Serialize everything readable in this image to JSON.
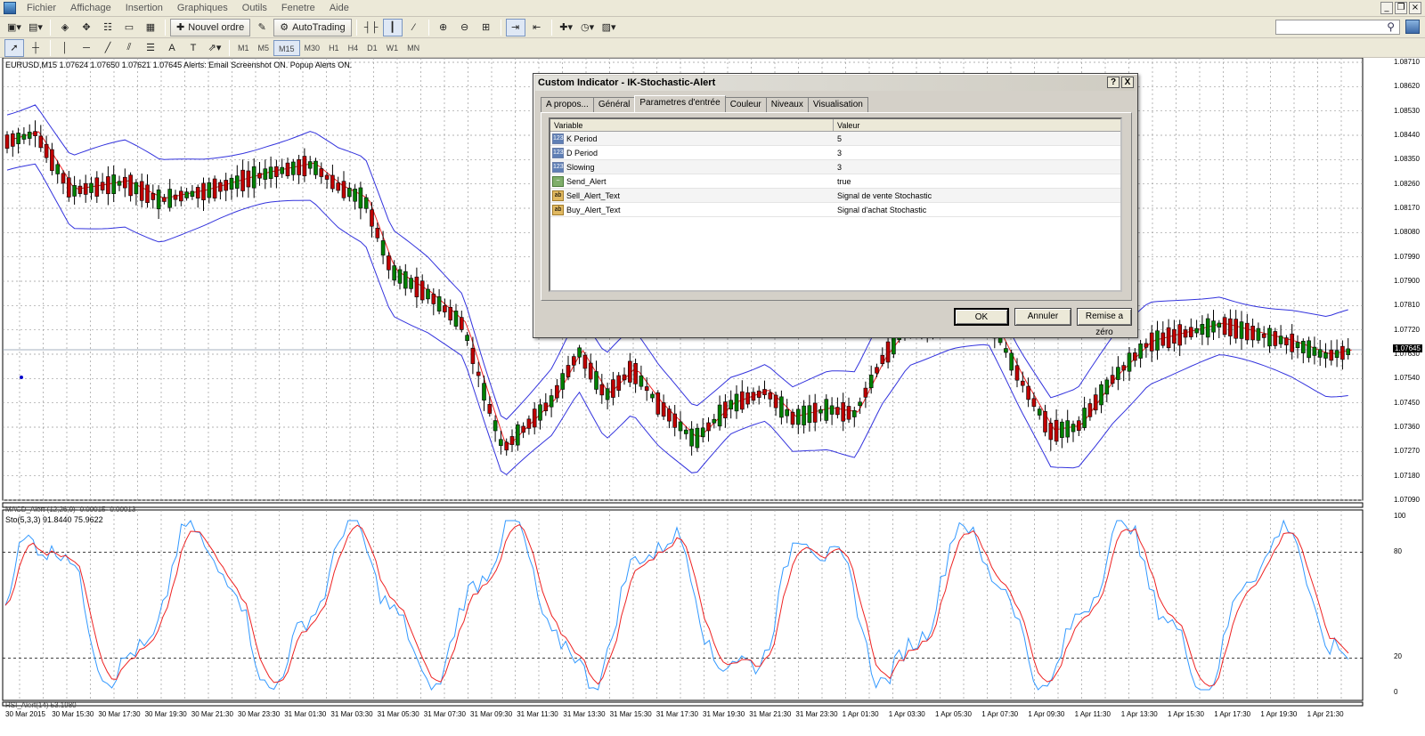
{
  "menubar": {
    "items": [
      "Fichier",
      "Affichage",
      "Insertion",
      "Graphiques",
      "Outils",
      "Fenetre",
      "Aide"
    ]
  },
  "toolbar": {
    "new_order_label": "Nouvel ordre",
    "autotrading_label": "AutoTrading",
    "timeframes": [
      "M1",
      "M5",
      "M15",
      "M30",
      "H1",
      "H4",
      "D1",
      "W1",
      "MN"
    ],
    "active_timeframe": "M15"
  },
  "chart": {
    "header": "EURUSD,M15  1.07624 1.07650 1.07621 1.07645  Alerts:  Email Screenshot ON.  Popup Alerts ON.",
    "macd_label": "MACD_Alert (12,26,9) -0.00015 -0.00013",
    "sto_label": "Sto(5,3,3) 91.8440 75.9622",
    "rsi_label": "RSI_Alert(14) 53.1980",
    "price_labels": [
      "1.08710",
      "1.08620",
      "1.08530",
      "1.08440",
      "1.08350",
      "1.08260",
      "1.08170",
      "1.08080",
      "1.07990",
      "1.07900",
      "1.07810",
      "1.07720",
      "1.07630",
      "1.07540",
      "1.07450",
      "1.07360",
      "1.07270",
      "1.07180",
      "1.07090"
    ],
    "current_price": "1.07645",
    "sto_scale": [
      "100",
      "80",
      "20",
      "0"
    ],
    "time_labels": [
      "30 Mar 2015",
      "30 Mar 15:30",
      "30 Mar 17:30",
      "30 Mar 19:30",
      "30 Mar 21:30",
      "30 Mar 23:30",
      "31 Mar 01:30",
      "31 Mar 03:30",
      "31 Mar 05:30",
      "31 Mar 07:30",
      "31 Mar 09:30",
      "31 Mar 11:30",
      "31 Mar 13:30",
      "31 Mar 15:30",
      "31 Mar 17:30",
      "31 Mar 19:30",
      "31 Mar 21:30",
      "31 Mar 23:30",
      "1 Apr 01:30",
      "1 Apr 03:30",
      "1 Apr 05:30",
      "1 Apr 07:30",
      "1 Apr 09:30",
      "1 Apr 11:30",
      "1 Apr 13:30",
      "1 Apr 15:30",
      "1 Apr 17:30",
      "1 Apr 19:30",
      "1 Apr 21:30"
    ],
    "colors": {
      "bull": "#008000",
      "bear": "#c00000",
      "bands": "#3333dd",
      "ma": "#ee2222",
      "sto_main": "#3399ff",
      "sto_signal": "#ee2222"
    }
  },
  "dialog": {
    "title": "Custom Indicator - IK-Stochastic-Alert",
    "help_label": "?",
    "close_label": "X",
    "tabs": [
      "A propos...",
      "Général",
      "Parametres d'entrée",
      "Couleur",
      "Niveaux",
      "Visualisation"
    ],
    "active_tab": "Parametres d'entrée",
    "columns": {
      "variable": "Variable",
      "value": "Valeur"
    },
    "params": [
      {
        "type": "int",
        "icon": "123",
        "name": "K Period",
        "value": "5"
      },
      {
        "type": "int",
        "icon": "123",
        "name": "D Period",
        "value": "3"
      },
      {
        "type": "int",
        "icon": "123",
        "name": "Slowing",
        "value": "3"
      },
      {
        "type": "bool",
        "icon": "~",
        "name": "Send_Alert",
        "value": "true"
      },
      {
        "type": "string",
        "icon": "ab",
        "name": "Sell_Alert_Text",
        "value": "Signal de vente Stochastic"
      },
      {
        "type": "string",
        "icon": "ab",
        "name": "Buy_Alert_Text",
        "value": "Signal d'achat Stochastic"
      }
    ],
    "ok_label": "OK",
    "cancel_label": "Annuler",
    "reset_label": "Remise a zéro"
  }
}
